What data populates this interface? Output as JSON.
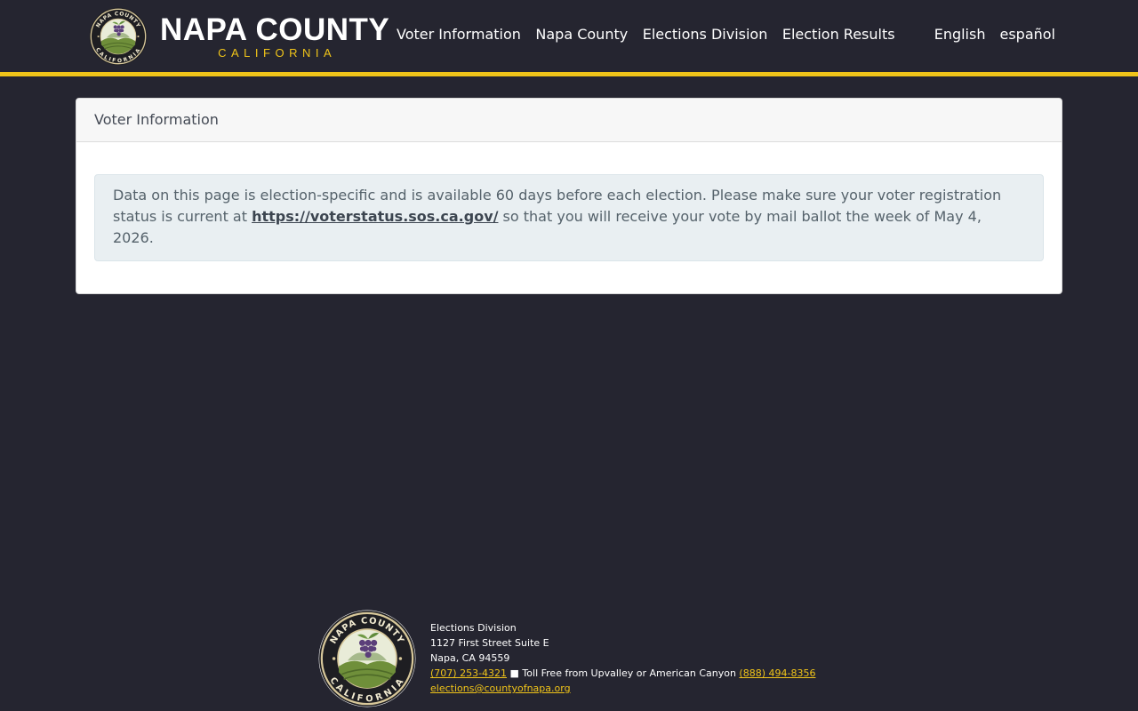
{
  "header": {
    "brand_name": "NAPA COUNTY",
    "brand_sub": "CALIFORNIA",
    "seal_text_top": "NAPA COUNTY",
    "seal_text_bottom": "CALIFORNIA",
    "nav": [
      "Voter Information",
      "Napa County",
      "Elections Division",
      "Election Results"
    ],
    "languages": [
      "English",
      "español"
    ]
  },
  "card": {
    "title": "Voter Information",
    "alert_before": "Data on this page is election-specific and is available 60 days before each election. Please make sure your voter registration status is current at ",
    "alert_link": "https://voterstatus.sos.ca.gov/",
    "alert_after": " so that you will receive your vote by mail ballot the week of May 4, 2026."
  },
  "footer": {
    "division": "Elections Division",
    "street": "1127 First Street Suite E",
    "city": "Napa, CA 94559",
    "phone": "(707) 253-4321",
    "separator": " ■ Toll Free from Upvalley or American Canyon ",
    "toll_free": "(888) 494-8356",
    "email": "elections@countyofnapa.org"
  },
  "colors": {
    "background": "#252530",
    "accent": "#f0c419",
    "card": "#ffffff",
    "alert": "#e9eff2"
  },
  "icons": {
    "seal": "napa-county-seal-icon"
  }
}
